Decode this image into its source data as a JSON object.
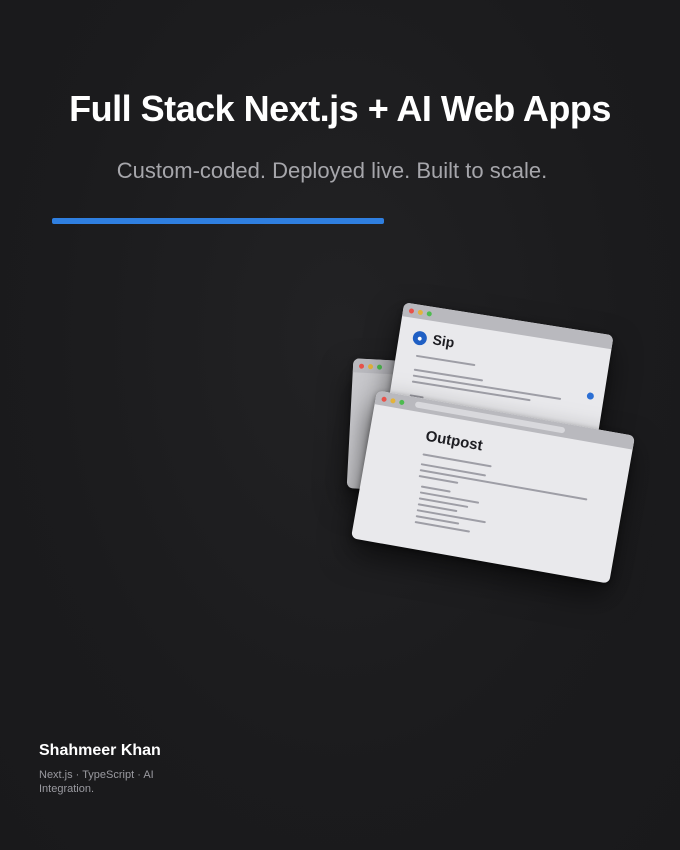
{
  "header": {
    "title": "Full Stack Next.js + AI Web Apps",
    "subtitle": "Custom-coded. Deployed live. Built to scale."
  },
  "colors": {
    "background": "#1b1b1d",
    "accent": "#2f7fe0",
    "title": "#ffffff",
    "subtitle": "#a6a6ab"
  },
  "mockups": {
    "back_window": {
      "app_name": "Sip",
      "logo_icon": "blue-circle-logo-icon"
    },
    "front_window": {
      "app_name": "Outpost"
    }
  },
  "footer": {
    "author": "Shahmeer Khan",
    "tags": "Next.js · TypeScript · AI Integration."
  }
}
